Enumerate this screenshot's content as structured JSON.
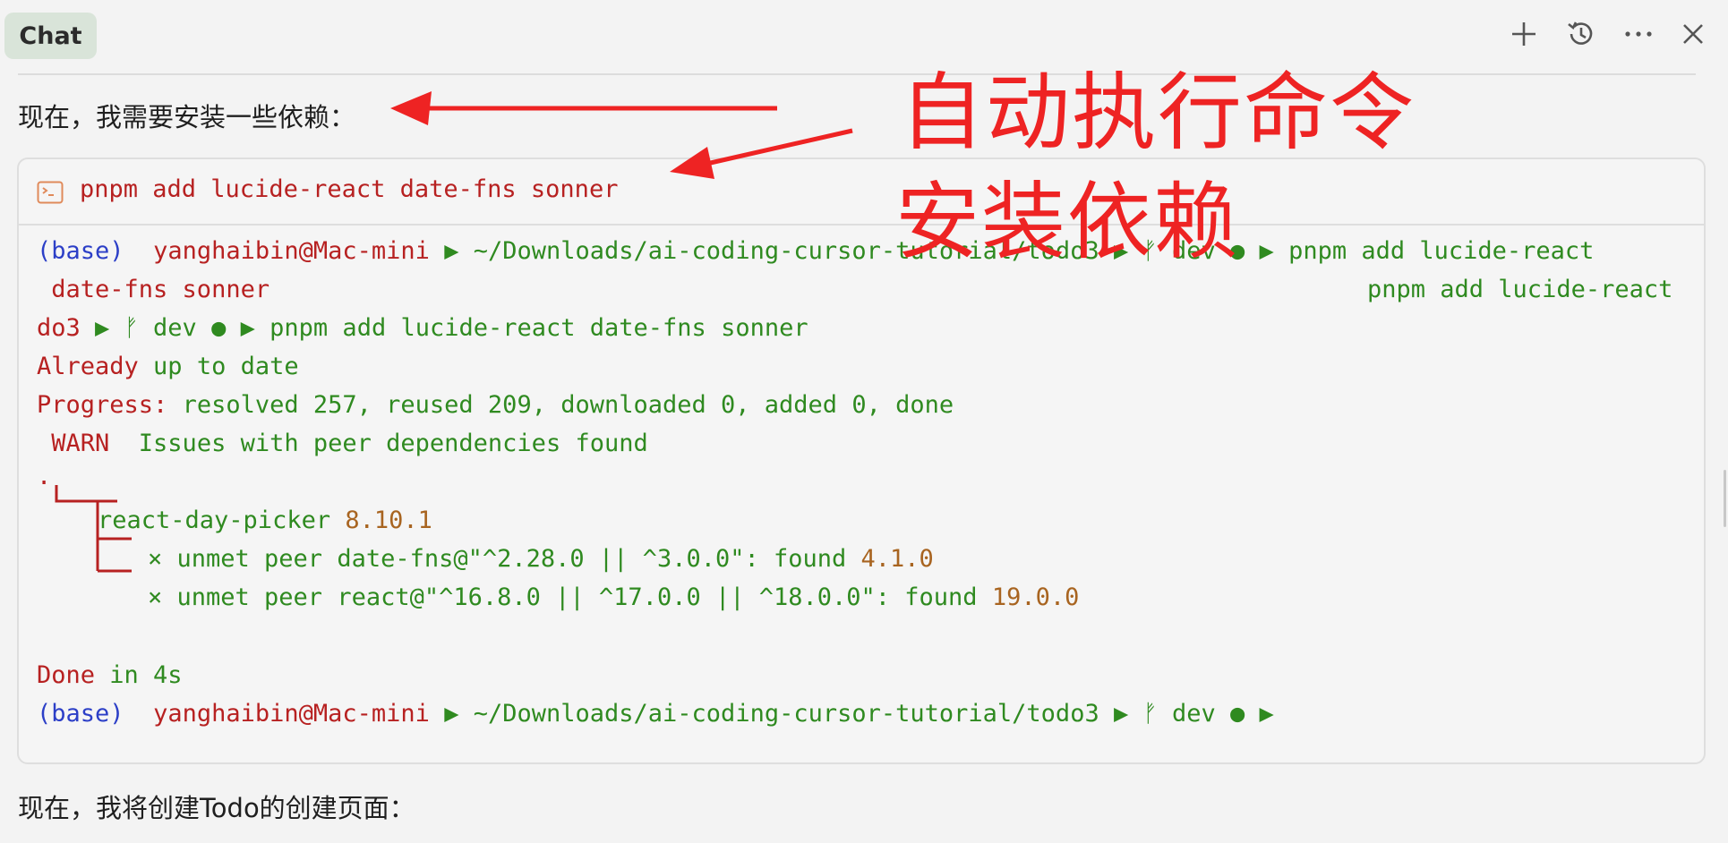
{
  "header": {
    "tab_label": "Chat",
    "icons": [
      "plus-icon",
      "history-icon",
      "more-icon",
      "close-icon"
    ]
  },
  "messages": {
    "first": "现在，我需要安装一些依赖：",
    "second": "现在，我将创建Todo的创建页面："
  },
  "terminal": {
    "command": "pnpm add lucide-react date-fns sonner",
    "prompt_env": "(base)",
    "prompt_user": "yanghaibin@Mac-mini",
    "prompt_path": "~/Downloads/ai-coding-cursor-tutorial/todo3",
    "prompt_branch": "dev",
    "line1_cmd": "pnpm add lucide-react",
    "line2_left": " date-fns sonner",
    "line2_right": "pnpm add lucide-react",
    "line3_prefix": "do3",
    "line3_branch": "dev",
    "line3_cmd": "pnpm add lucide-react date-fns sonner",
    "already": "Already",
    "already_rest": " up to date",
    "progress_label": "Progress:",
    "progress_rest": " resolved 257, reused 209, downloaded 0, added 0, done",
    "warn": " WARN",
    "warn_rest": "  Issues with peer dependencies found",
    "dot": ".",
    "tree_root_pkg": "react-day-picker",
    "tree_root_ver": "8.10.1",
    "tree_item1_text": "× unmet peer date-fns@\"^2.28.0 || ^3.0.0\": found ",
    "tree_item1_ver": "4.1.0",
    "tree_item2_text": "× unmet peer react@\"^16.8.0 || ^17.0.0 || ^18.0.0\": found ",
    "tree_item2_ver": "19.0.0",
    "done_label": "Done",
    "done_rest": " in 4s"
  },
  "annotation": {
    "line1": "自动执行命令",
    "line2": "安装依赖",
    "color": "#ee2323"
  },
  "colors": {
    "red_text": "#b72121",
    "green_text": "#2f8a20",
    "blue_text": "#2c3fc7",
    "orange_text": "#a86420"
  }
}
